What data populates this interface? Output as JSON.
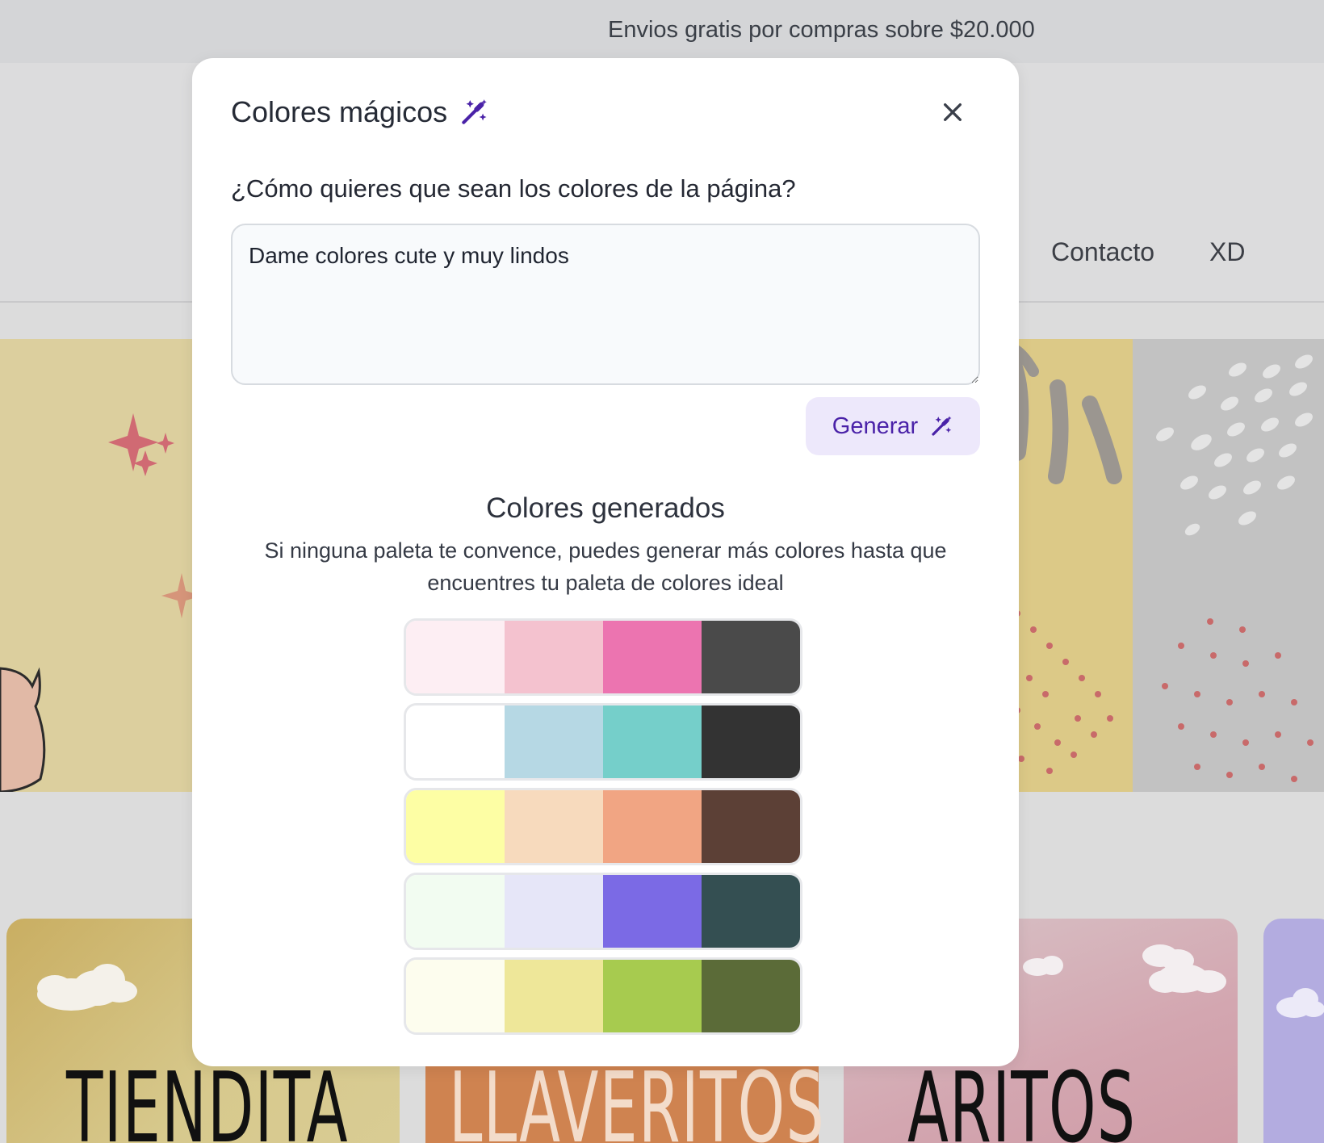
{
  "announcement": {
    "text": "Envios gratis por compras sobre $20.000"
  },
  "nav": {
    "contact": "Contacto",
    "xd": "XD"
  },
  "categories": [
    {
      "title": "TIENDITA"
    },
    {
      "title": "LLAVERITOS"
    },
    {
      "title": "ARITOS"
    }
  ],
  "modal": {
    "title": "Colores mágicos",
    "title_icon": "magic-wand-icon",
    "close_icon": "close-icon",
    "question": "¿Cómo quieres que sean los colores de la página?",
    "prompt_value": "Dame colores cute y muy lindos",
    "generate_label": "Generar",
    "generated_heading": "Colores generados",
    "generated_subtext": "Si ninguna paleta te convence, puedes generar más colores hasta que encuentres tu paleta de colores ideal",
    "palettes": [
      [
        "#fdeef3",
        "#f4c2cf",
        "#ec74b0",
        "#4a4a4a"
      ],
      [
        "#ffffff",
        "#b6d8e4",
        "#75cfca",
        "#333333"
      ],
      [
        "#fdfea4",
        "#f7dabd",
        "#f1a583",
        "#5c4036"
      ],
      [
        "#f2fcf1",
        "#e6e6f8",
        "#7b6ae5",
        "#344f52"
      ],
      [
        "#fdfdee",
        "#eee799",
        "#a7cb4f",
        "#5b6b38"
      ]
    ]
  },
  "colors": {
    "accent": "#4a22a8",
    "accent_bg": "#ede8fb",
    "overlay": "#dcdcdc"
  }
}
